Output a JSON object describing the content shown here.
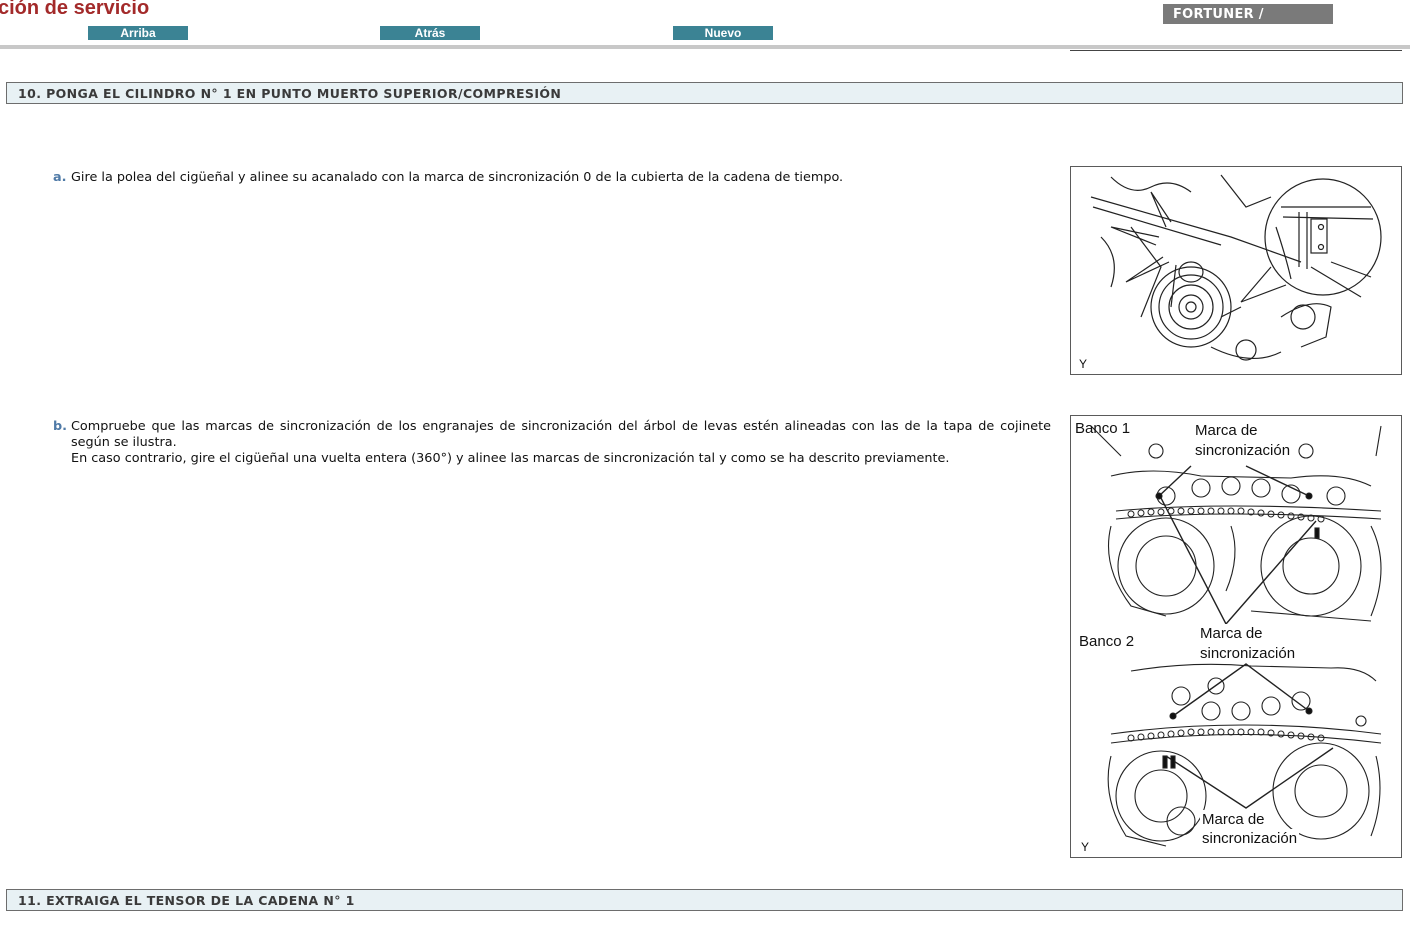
{
  "header": {
    "title": "ción de servicio",
    "nav": [
      "Arriba",
      "Atrás",
      "Nuevo"
    ],
    "model": "FORTUNER /"
  },
  "sections": [
    {
      "heading": "10. PONGA EL CILINDRO N° 1 EN PUNTO MUERTO SUPERIOR/COMPRESIÓN",
      "steps": [
        {
          "letter": "a.",
          "lines": [
            "Gire la polea del cigüeñal y alinee su acanalado con la marca de sincronización 0 de la cubierta de la cadena de tiempo."
          ],
          "figure": {
            "code": "Y"
          }
        },
        {
          "letter": "b.",
          "lines": [
            "Compruebe que las marcas de sincronización de los engranajes de sincronización del árbol de levas estén alineadas con las de la tapa de cojinete según se ilustra.",
            "En caso contrario, gire el cigüeñal una vuelta entera (360°) y alinee las marcas de sincronización tal y como se ha descrito previamente."
          ],
          "figure": {
            "code": "Y",
            "bank1": "Banco 1",
            "bank2": "Banco 2",
            "mark_line1": "Marca de",
            "mark_line2": "sincronización"
          }
        }
      ]
    },
    {
      "heading": "11. EXTRAIGA EL TENSOR DE LA CADENA N° 1"
    }
  ],
  "colors": {
    "title": "#a32a2a",
    "nav_button": "#3b8394",
    "model_badge": "#7a7a7a",
    "section_bar": "#e8f1f4",
    "step_letter": "#4f7aa7"
  }
}
